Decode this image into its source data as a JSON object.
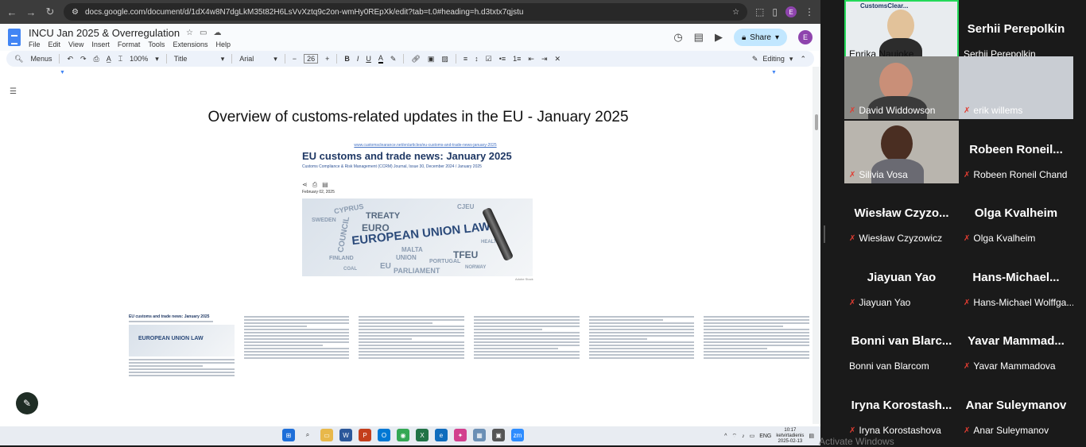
{
  "browser": {
    "url": "docs.google.com/document/d/1dX4w8N7dgLkM35t82H6LsVvXztq9c2on-wmHy0REpXk/edit?tab=t.0#heading=h.d3txtx7qjstu",
    "profile_initial": "E"
  },
  "docs": {
    "title": "INCU Jan 2025 & Overregulation",
    "menus": [
      "File",
      "Edit",
      "View",
      "Insert",
      "Format",
      "Tools",
      "Extensions",
      "Help"
    ],
    "share_label": "Share",
    "user_initial": "E"
  },
  "toolbar": {
    "search_label": "Menus",
    "zoom": "100%",
    "style": "Title",
    "font": "Arial",
    "font_size": "26",
    "mode": "Editing"
  },
  "document": {
    "heading": "Overview of customs-related updates in the EU - January 2025",
    "article_url": "www.customsclearance.net/en/articles/eu-customs-and-trade-news-january-2025",
    "article_title": "EU customs and trade news: January 2025",
    "article_subtitle": "Customs Compliance & Risk Management (CCRM) Journal, Issue 30, December 2024 / January 2025",
    "article_date": "February 02, 2025",
    "image_words": [
      "CYPRUS",
      "TREATY",
      "EURO",
      "COUNCIL",
      "EUROPEAN UNION LAW",
      "HEALTH",
      "MALTA",
      "UNION",
      "TFEU",
      "FINLAND",
      "PORTUGAL",
      "EU",
      "PARLIAMENT",
      "SWEDEN",
      "COAL",
      "NORWAY",
      "CJEU"
    ],
    "image_credit": "Adobe Stock",
    "thumb_title": "EU customs and trade news: January 2025",
    "thumb_image_text": "EUROPEAN UNION LAW"
  },
  "taskbar": {
    "time": "10:17",
    "day": "ketvirtadienis",
    "date": "2025-02-13",
    "lang": "ENG"
  },
  "meeting": {
    "participants": [
      {
        "name": "Enrika Naujoke",
        "video": true,
        "muted": false,
        "active": true
      },
      {
        "name": "Serhii Perepolkin",
        "display": "Serhii Perepolkin",
        "video": false,
        "muted": false
      },
      {
        "name": "David Widdowson",
        "video": true,
        "muted": true
      },
      {
        "name": "erik willems",
        "video": true,
        "muted": true
      },
      {
        "name": "Silivia Vosa",
        "video": true,
        "muted": true
      },
      {
        "name": "Robeen Roneil Chand",
        "display": "Robeen Roneil...",
        "video": false,
        "muted": true
      },
      {
        "name": "Wiesław Czyzowicz",
        "display": "Wiesław Czyzo...",
        "video": false,
        "muted": true
      },
      {
        "name": "Olga Kvalheim",
        "display": "Olga Kvalheim",
        "video": false,
        "muted": true
      },
      {
        "name": "Jiayuan Yao",
        "display": "Jiayuan Yao",
        "video": false,
        "muted": true
      },
      {
        "name": "Hans-Michael Wolffga...",
        "display": "Hans-Michael...",
        "video": false,
        "muted": true
      },
      {
        "name": "Bonni van Blarcom",
        "display": "Bonni van Blarc...",
        "video": false,
        "muted": false
      },
      {
        "name": "Yavar Mammadova",
        "display": "Yavar Mammad...",
        "video": false,
        "muted": true
      },
      {
        "name": "Iryna Korostashova",
        "display": "Iryna Korostash...",
        "video": false,
        "muted": true
      },
      {
        "name": "Anar Suleymanov",
        "display": "Anar Suleymanov",
        "video": false,
        "muted": true
      }
    ],
    "logo_text": "CustomsClear...",
    "watermark": "Activate Windows"
  }
}
